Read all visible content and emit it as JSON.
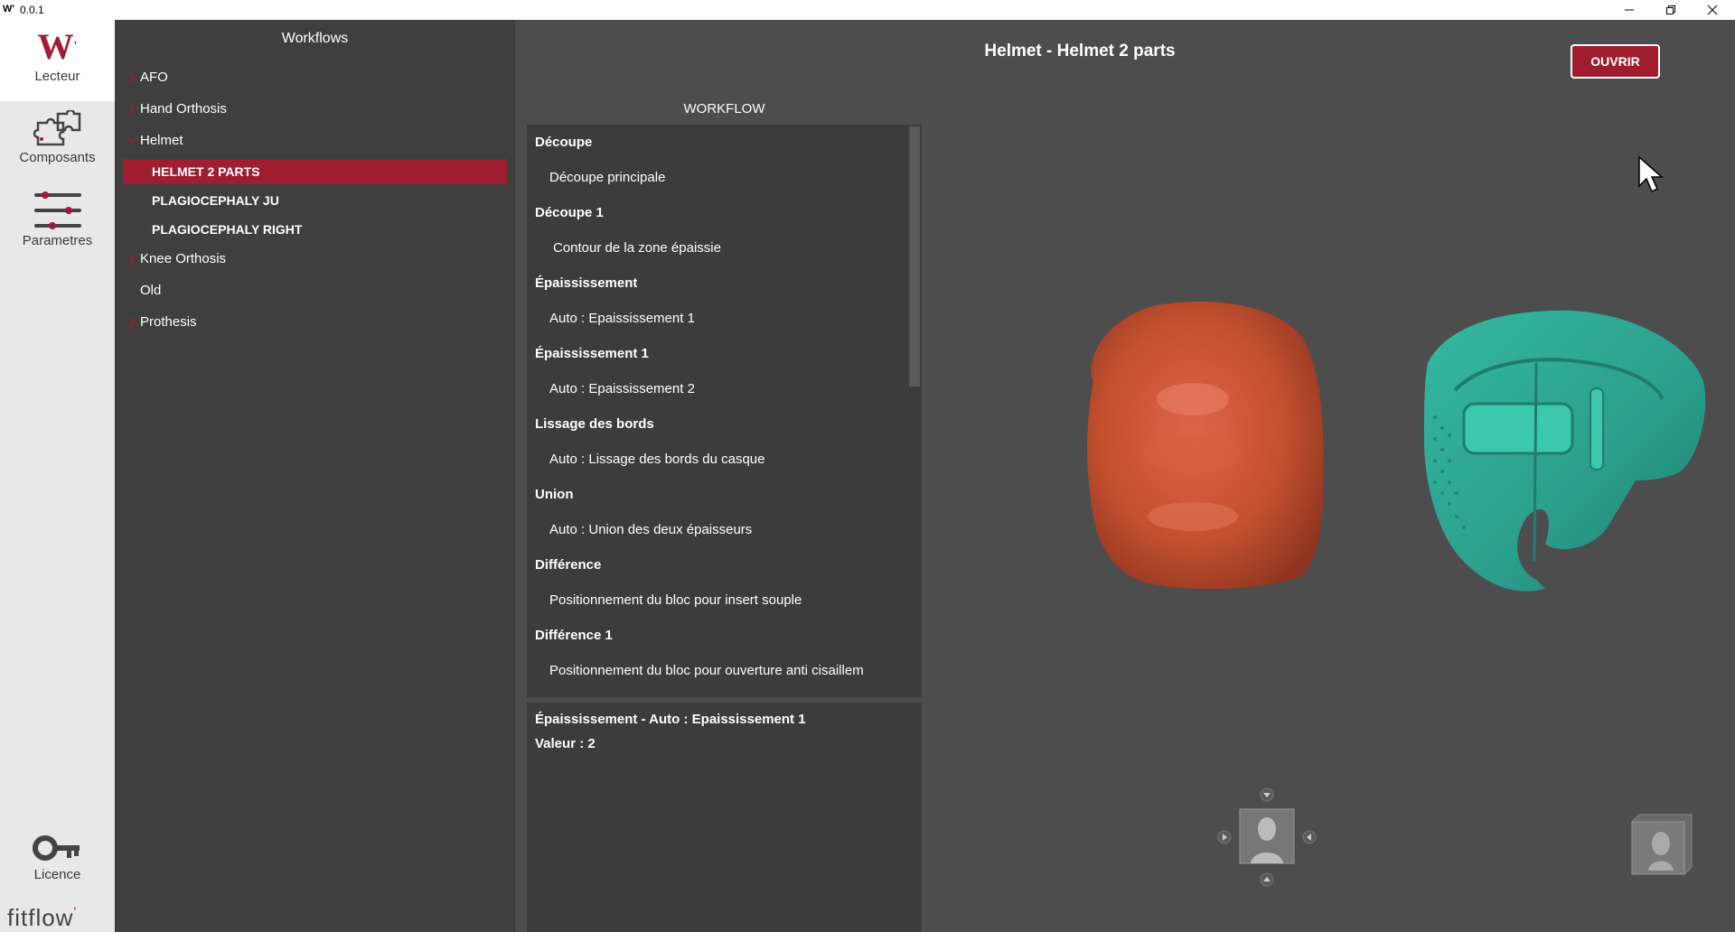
{
  "titlebar": {
    "app_icon": "W'",
    "version": "0.0.1"
  },
  "rail": {
    "items": [
      {
        "label": "Lecteur",
        "icon": "w-logo-icon"
      },
      {
        "label": "Composants",
        "icon": "puzzle-icon"
      },
      {
        "label": "Parametres",
        "icon": "sliders-icon"
      },
      {
        "label": "Licence",
        "icon": "key-icon"
      }
    ],
    "brand": "fitflow"
  },
  "tree": {
    "header": "Workflows",
    "items": [
      {
        "label": "AFO",
        "level": 0,
        "expander": "collapsed"
      },
      {
        "label": "Hand Orthosis",
        "level": 0,
        "expander": "collapsed"
      },
      {
        "label": "Helmet",
        "level": 0,
        "expander": "expanded"
      },
      {
        "label": "HELMET 2 PARTS",
        "level": 1,
        "selected": true
      },
      {
        "label": "PLAGIOCEPHALY JU",
        "level": 1
      },
      {
        "label": "PLAGIOCEPHALY RIGHT",
        "level": 1
      },
      {
        "label": "Knee Orthosis",
        "level": 0,
        "expander": "collapsed"
      },
      {
        "label": "Old",
        "level": 0
      },
      {
        "label": "Prothesis",
        "level": 0,
        "expander": "collapsed"
      }
    ]
  },
  "main": {
    "title": "Helmet - Helmet 2 parts",
    "open_button": "OUVRIR",
    "workflow_label": "WORKFLOW",
    "steps": [
      {
        "label": "Découpe",
        "type": "group"
      },
      {
        "label": "Découpe principale",
        "type": "step"
      },
      {
        "label": "Découpe 1",
        "type": "group"
      },
      {
        "label": "Contour de la zone épaissie",
        "type": "step"
      },
      {
        "label": "Épaississement",
        "type": "group"
      },
      {
        "label": "Auto : Epaississement 1",
        "type": "step"
      },
      {
        "label": "Épaississement 1",
        "type": "group"
      },
      {
        "label": "Auto : Epaississement 2",
        "type": "step"
      },
      {
        "label": "Lissage des bords",
        "type": "group"
      },
      {
        "label": "Auto : Lissage des bords du casque",
        "type": "step"
      },
      {
        "label": "Union",
        "type": "group"
      },
      {
        "label": "Auto : Union des deux épaisseurs",
        "type": "step"
      },
      {
        "label": "Différence",
        "type": "group"
      },
      {
        "label": "Positionnement du bloc pour insert souple",
        "type": "step"
      },
      {
        "label": "Différence 1",
        "type": "group"
      },
      {
        "label": "Positionnement du bloc pour ouverture anti cisaillem",
        "type": "step"
      }
    ],
    "detail": {
      "line1": "Épaississement - Auto : Epaississement 1",
      "line2": "Valeur : 2"
    }
  },
  "colors": {
    "accent": "#a01d2f",
    "head_model": "#c2502e",
    "helmet_model": "#2a9e8c"
  }
}
